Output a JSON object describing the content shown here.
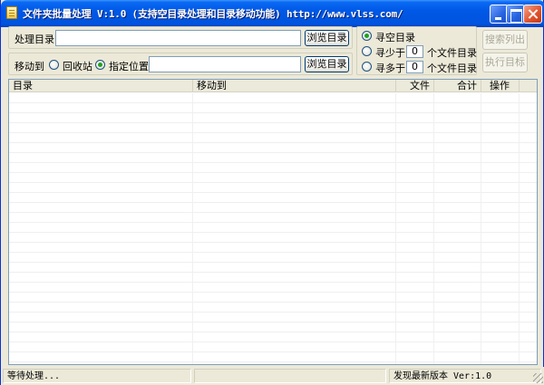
{
  "window": {
    "title": "文件夹批量处理 V:1.0 (支持空目录处理和目录移动功能) http://www.vlss.com/"
  },
  "source": {
    "label": "处理目录",
    "path_value": "",
    "browse_label": "浏览目录"
  },
  "move_to": {
    "label": "移动到",
    "options": [
      {
        "label": "回收站",
        "checked": false
      },
      {
        "label": "指定位置",
        "checked": true
      }
    ],
    "path_value": "",
    "browse_label": "浏览目录"
  },
  "search_mode": {
    "options": [
      {
        "label": "寻空目录",
        "checked": true
      },
      {
        "prefix": "寻少于",
        "count": "0",
        "suffix": "个文件目录",
        "checked": false
      },
      {
        "prefix": "寻多于",
        "count": "0",
        "suffix": "个文件目录",
        "checked": false
      }
    ]
  },
  "actions": {
    "search_label": "搜索列出",
    "execute_label": "执行目标"
  },
  "table": {
    "columns": [
      "目录",
      "移动到",
      "文件",
      "合计",
      "操作"
    ],
    "rows": []
  },
  "status": {
    "left": "等待处理...",
    "middle": "",
    "right": "发现最新版本 Ver:1.0"
  }
}
